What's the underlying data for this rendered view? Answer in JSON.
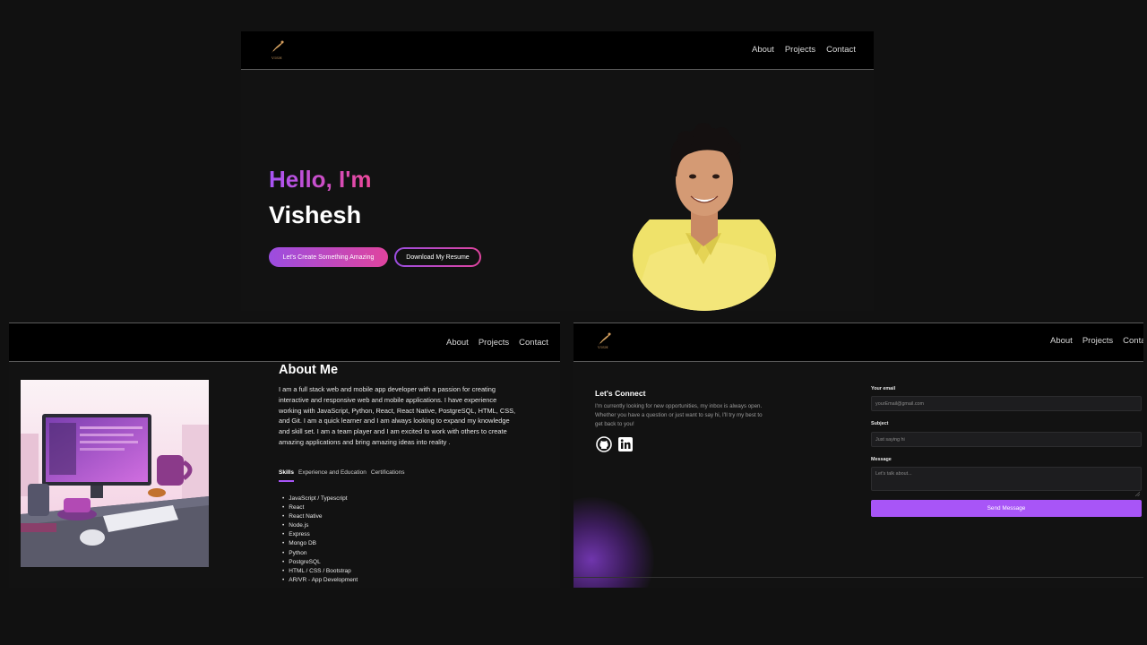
{
  "hero": {
    "logo_text": "VISH",
    "nav": [
      "About",
      "Projects",
      "Contact"
    ],
    "greeting": "Hello, I'm",
    "name": "Vishesh",
    "primary_button": "Let's Create Something Amazing",
    "secondary_button": "Download My Resume"
  },
  "about": {
    "nav": [
      "About",
      "Projects",
      "Contact"
    ],
    "title": "About Me",
    "description": "I am a full stack web and mobile app developer with a passion for creating interactive and responsive web and mobile applications. I have experience working with JavaScript, Python, React, React Native, PostgreSQL, HTML, CSS, and Git. I am a quick learner and I am always looking to expand my knowledge and skill set. I am a team player and I am excited to work with others to create amazing applications and bring amazing ideas into reality .",
    "tabs": [
      "Skills",
      "Experience and Education",
      "Certifications"
    ],
    "active_tab": "Skills",
    "skills": [
      "JavaScript / Typescript",
      "React",
      "React Native",
      "Node.js",
      "Express",
      "Mongo DB",
      "Python",
      "PostgreSQL",
      "HTML / CSS / Bootstrap",
      "AR/VR - App Development"
    ]
  },
  "contact": {
    "logo_text": "VISH",
    "nav": [
      "About",
      "Projects",
      "Contact"
    ],
    "title": "Let's Connect",
    "description": "I'm currently looking for new opportunities, my inbox is always open. Whether you have a question or just want to say hi, I'll try my best to get back to you!",
    "email_label": "Your email",
    "email_placeholder": "yourEmail@gmail.com",
    "subject_label": "Subject",
    "subject_placeholder": "Just saying hi",
    "message_label": "Message",
    "message_placeholder": "Let's talk about...",
    "send_button": "Send Message"
  },
  "colors": {
    "accent": "#a855f7",
    "gradient_start": "#a855f7",
    "gradient_end": "#ec4899",
    "background": "#121212"
  },
  "icons": [
    "logo-icon",
    "github-icon",
    "linkedin-icon"
  ]
}
